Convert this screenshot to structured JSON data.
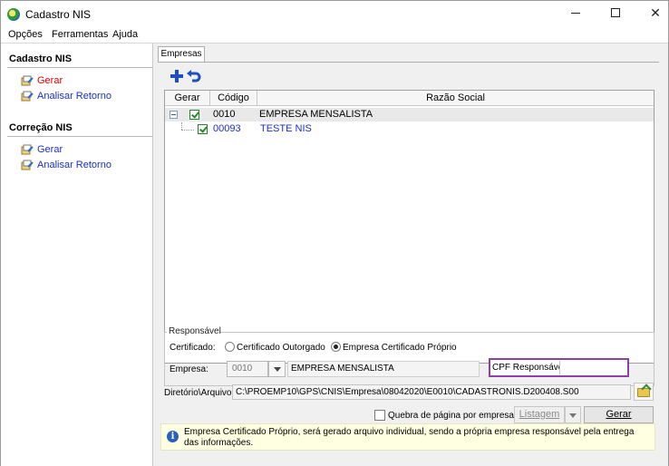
{
  "window": {
    "title": "Cadastro NIS"
  },
  "menu": {
    "items": [
      "Opções",
      "Ferramentas",
      "Ajuda"
    ]
  },
  "sidebar": {
    "sections": [
      {
        "header": "Cadastro NIS",
        "links": [
          "Gerar",
          "Analisar Retorno"
        ]
      },
      {
        "header": "Correção NIS",
        "links": [
          "Gerar",
          "Analisar Retorno"
        ]
      }
    ]
  },
  "main": {
    "tab": "Empresas",
    "grid": {
      "columns": [
        "Gerar",
        "Código",
        "Razão Social"
      ],
      "rows": [
        {
          "code": "0010",
          "name": "EMPRESA MENSALISTA",
          "checked": true,
          "expanded": true
        },
        {
          "code": "00093",
          "name": "TESTE NIS",
          "checked": true
        }
      ]
    },
    "responsavel": {
      "legend": "Responsável",
      "certificado_label": "Certificado:",
      "option_outorgado": "Certificado Outorgado",
      "option_proprio": "Empresa Certificado Próprio",
      "selected": "Empresa Certificado Próprio",
      "empresa_label": "Empresa:",
      "empresa_code": "0010",
      "empresa_name": "EMPRESA MENSALISTA",
      "cpf_label": "CPF Responsável:",
      "cpf_value": ""
    },
    "diretorio": {
      "label": "Diretório\\Arquivo:",
      "value": "C:\\PROEMP10\\GPS\\CNIS\\Empresa\\08042020\\E0010\\CADASTRONIS.D200408.S00"
    },
    "quebra_label": "Quebra de página por empresa",
    "listagem_label": "Listagem",
    "gerar_label": "Gerar",
    "info_text": "Empresa Certificado Próprio, será gerado arquivo individual, sendo a própria empresa responsável pela entrega das informações."
  },
  "colors": {
    "accent_purple": "#8e3fa8",
    "link_red": "#e20000",
    "link_blue": "#1a2fcc",
    "info_bg": "#ffffe1"
  }
}
